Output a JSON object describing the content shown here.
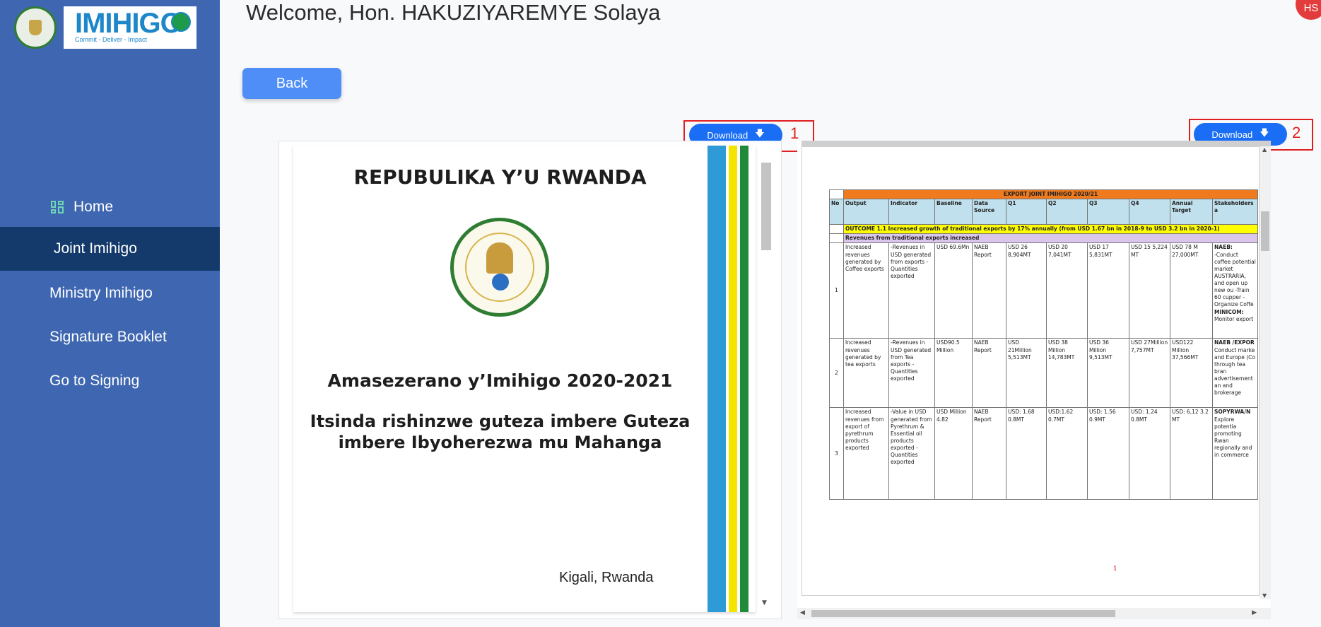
{
  "sidebar": {
    "logo_text": "IMIHIGO",
    "logo_tagline": "Commit - Deliver - Impact",
    "items": [
      {
        "label": "Home"
      },
      {
        "label": "Joint Imihigo"
      },
      {
        "label": "Ministry Imihigo"
      },
      {
        "label": "Signature Booklet"
      },
      {
        "label": "Go to Signing"
      }
    ]
  },
  "header": {
    "welcome": "Welcome,  Hon.  HAKUZIYAREMYE Solaya",
    "avatar_initials": "HS"
  },
  "back_label": "Back",
  "download_label": "Download",
  "markers": [
    "1",
    "2"
  ],
  "doc1": {
    "title": "REPUBULIKA Y’U RWANDA",
    "heading": "Amasezerano y’Imihigo 2020-2021",
    "subheading_line1": "Itsinda rishinzwe guteza imbere Guteza",
    "subheading_line2": "imbere Ibyoherezwa mu Mahanga",
    "location": "Kigali, Rwanda",
    "flag_colors": [
      "#2e9bd6",
      "#ffffff",
      "#f5e400",
      "#ffffff",
      "#1f8a3a"
    ]
  },
  "doc2": {
    "table_title": "EXPORT JOINT IMIHIGO 2020/21",
    "columns": [
      "No",
      "Output",
      "Indicator",
      "Baseline",
      "Data Source",
      "Q1",
      "Q2",
      "Q3",
      "Q4",
      "Annual Target",
      "Stakeholders a"
    ],
    "outcome": "OUTCOME 1.1 Increased growth of traditional exports by 17% annually (from USD 1.67 bn in 2018-9 to USD 3.2 bn in 2020-1)",
    "revenues_row": "Revenues from traditional exports increased",
    "rows": [
      {
        "no": "1",
        "output": "Increased revenues generated by Coffee exports",
        "indicator": "-Revenues in USD generated from exports -Quantities exported",
        "baseline": "USD 69.6Mn",
        "source": "NAEB Report",
        "q1": "USD 26 8,904MT",
        "q2": "USD 20 7,041MT",
        "q3": "USD 17 5,831MT",
        "q4": "USD 15 5,224 MT",
        "target": "USD 78 M 27,000MT",
        "stake_head": "NAEB:",
        "stake": "-Conduct coffee potential market AUSTRARIA, and open up new ou -Train 60 cupper - Organize Coffe",
        "stake_head2": "MINICOM:",
        "stake2": "Monitor export"
      },
      {
        "no": "2",
        "output": "Increased revenues generated by tea exports",
        "indicator": "-Revenues in USD generated from Tea exports -Quantities exported",
        "baseline": "USD90.5 Million",
        "source": "NAEB Report",
        "q1": "USD 21Million 5,513MT",
        "q2": "USD 38 Million 14,783MT",
        "q3": "USD 36 Million 9,513MT",
        "q4": "USD 27Million 7,757MT",
        "target": "USD122 Million 37,566MT",
        "stake_head": "NAEB /EXPOR",
        "stake": "Conduct marke and Europe (Co through tea bran advertisement an and brokerage",
        "stake_head2": "",
        "stake2": ""
      },
      {
        "no": "3",
        "output": "Increased revenues from export of pyrethrum products exported",
        "indicator": "-Value in USD generated from Pyrethrum & Essential oil products exported -Quantities exported",
        "baseline": "USD Million 4.82",
        "source": "NAEB Report",
        "q1": "USD: 1.68 0.8MT",
        "q2": "USD:1.62 0.7MT",
        "q3": "USD: 1.56 0.9MT",
        "q4": "USD: 1.24 0.8MT",
        "target": "USD: 6,12 3.2 MT",
        "stake_head": "SOPYRWA/N",
        "stake": "Explore potentia promoting Rwan regionally and in commerce",
        "stake_head2": "",
        "stake2": ""
      }
    ],
    "page_number": "1"
  }
}
